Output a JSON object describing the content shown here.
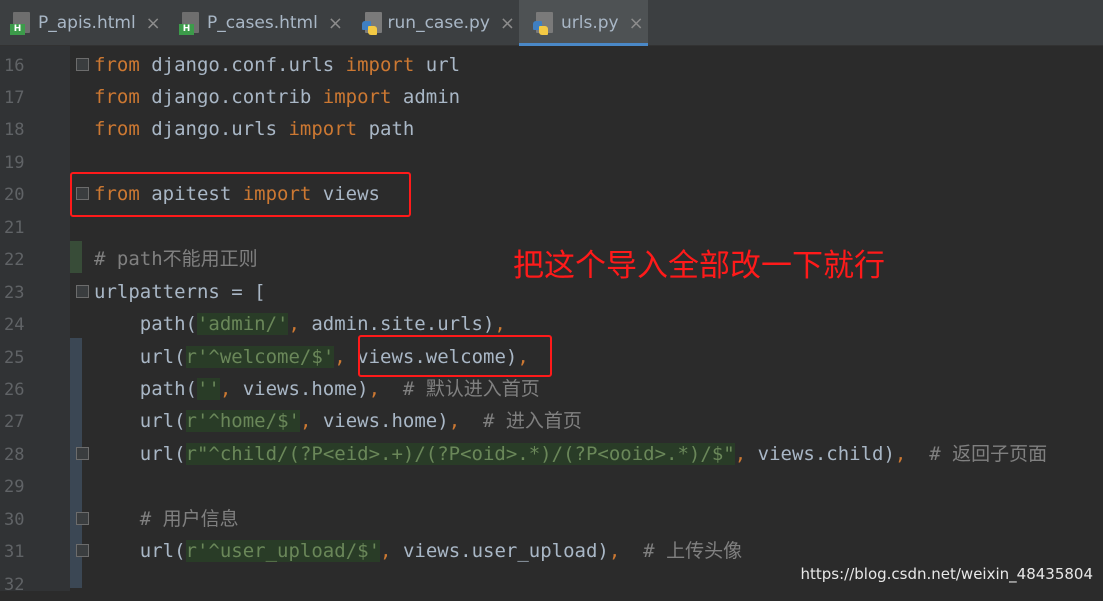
{
  "tabs": [
    {
      "name": "P_apis.html",
      "type": "html"
    },
    {
      "name": "P_cases.html",
      "type": "html"
    },
    {
      "name": "run_case.py",
      "type": "python"
    },
    {
      "name": "urls.py",
      "type": "python",
      "active": true
    }
  ],
  "close_glyph": "×",
  "line_numbers": [
    "16",
    "17",
    "18",
    "19",
    "20",
    "21",
    "22",
    "23",
    "24",
    "25",
    "26",
    "27",
    "28",
    "29",
    "30",
    "31",
    "32"
  ],
  "code": {
    "l16": {
      "kw1": "from",
      "t1": " django.conf.urls ",
      "kw2": "import",
      "t2": " url"
    },
    "l17": {
      "kw1": "from",
      "t1": " django.contrib ",
      "kw2": "import",
      "t2": " admin"
    },
    "l18": {
      "kw1": "from",
      "t1": " django.urls ",
      "kw2": "import",
      "t2": " path"
    },
    "l20": {
      "kw1": "from",
      "t1": " apitest ",
      "kw2": "import",
      "t2": " views"
    },
    "l22": {
      "comment_prefix": "# path",
      "comment_cn": "不能用正则"
    },
    "l23": {
      "text": "urlpatterns = ["
    },
    "l24": {
      "t1": "    path(",
      "s1": "'admin/'",
      "p1": ",",
      "t2": " admin.site.urls)",
      "p2": ","
    },
    "l25": {
      "t1": "    url(",
      "s1": "r'",
      "r1": "^",
      "s2": "welcome/",
      "r2": "$",
      "s3": "'",
      "p1": ",",
      "t2": " views.welcome)",
      "p2": ","
    },
    "l26": {
      "t1": "    path(",
      "s1": "''",
      "p1": ",",
      "t2": " views.home)",
      "p2": ",",
      "cm": "  # ",
      "cn": "默认进入首页"
    },
    "l27": {
      "t1": "    url(",
      "s1": "r'",
      "r1": "^",
      "s2": "home/",
      "r2": "$",
      "s3": "'",
      "p1": ",",
      "t2": " views.home)",
      "p2": ",",
      "cm": "  # ",
      "cn": "进入首页"
    },
    "l28": {
      "t1": "    url(",
      "s1": "r\"",
      "r1": "^",
      "s2": "child/",
      "r3": "(?P<eid>.+)",
      "s4": "/",
      "r4": "(?P<oid>.*)",
      "s5": "/",
      "r5": "(?P<ooid>.*)",
      "s6": "/",
      "r2": "$",
      "s3": "\"",
      "p1": ",",
      "t2": " views.child)",
      "p2": ",",
      "cm": "  # ",
      "cn": "返回子页面"
    },
    "l30": {
      "cm": "    # ",
      "cn": "用户信息"
    },
    "l31": {
      "t1": "    url(",
      "s1": "r'",
      "r1": "^",
      "s2": "user_upload/",
      "r2": "$",
      "s3": "'",
      "p1": ",",
      "t2": " views.user_upload)",
      "p2": ",",
      "cm": "  # ",
      "cn": "上传头像"
    }
  },
  "annotation": "把这个导入全部改一下就行",
  "watermark": "https://blog.csdn.net/weixin_48435804",
  "colors": {
    "keyword": "#cc7832",
    "string": "#6a8759",
    "comment": "#808080",
    "annotation": "#ff1a1a",
    "background": "#2b2b2b"
  }
}
